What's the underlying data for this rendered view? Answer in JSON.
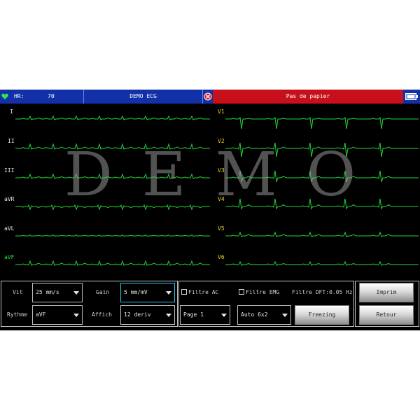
{
  "header": {
    "hr_label": "HR:",
    "hr_value": "70",
    "title": "DEMO ECG",
    "alert": "Pas de papier"
  },
  "watermark": "DEMO",
  "leads": {
    "left": [
      "I",
      "II",
      "III",
      "aVR",
      "aVL",
      "aVF"
    ],
    "right": [
      "V1",
      "V2",
      "V3",
      "V4",
      "V5",
      "V6"
    ]
  },
  "controls": {
    "speed": {
      "label": "Vit",
      "value": "25 mm/s"
    },
    "gain": {
      "label": "Gain",
      "value": "5 mm/mV"
    },
    "rhythm": {
      "label": "Rythme",
      "value": "aVF"
    },
    "display": {
      "label": "Affich",
      "value": "12 deriv"
    },
    "filter_ac": "Filtre AC",
    "filter_emg": "Filtre EMG",
    "filter_dft": "Filtre DFT:0.05 Hz",
    "page": "Page 1",
    "format": "Auto 6x2",
    "freeze": "Freezing",
    "print": "Imprim",
    "back": "Retour"
  },
  "colors": {
    "trace": "#22d43a",
    "topbar_blue": "#1230a8",
    "alert_red": "#c8101c",
    "focus": "#25c4e6"
  }
}
